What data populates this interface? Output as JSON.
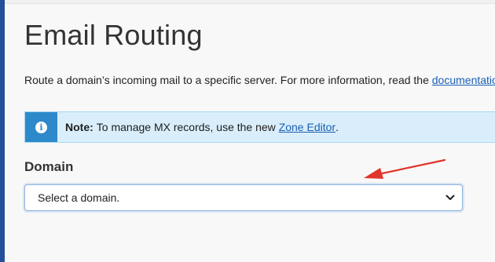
{
  "page": {
    "title": "Email Routing",
    "description_text": "Route a domain’s incoming mail to a specific server. For more information, read the ",
    "description_link": "documentation."
  },
  "alert": {
    "icon": "info-icon",
    "note_label": "Note:",
    "text": "To manage MX records, use the new ",
    "link": "Zone Editor",
    "suffix": ".",
    "colors": {
      "background": "#d9eefa",
      "icon_box": "#2d89c9",
      "border": "#a9d6f0"
    }
  },
  "domain": {
    "label": "Domain",
    "selected_value": "Select a domain."
  },
  "annotation": {
    "arrow_color": "#e0352b"
  },
  "colors": {
    "sidebar_edge": "#22509a",
    "link": "#1a5fb4",
    "background": "#f8f8f8"
  }
}
